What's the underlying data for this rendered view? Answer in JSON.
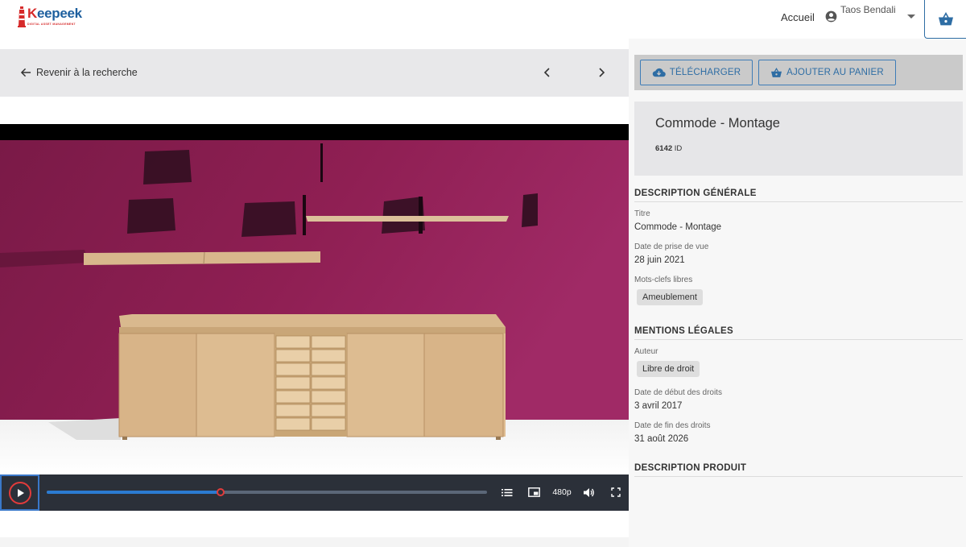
{
  "header": {
    "logo_word_k": "K",
    "logo_word_rest": "eepeek",
    "logo_sub": "DIGITAL ASSET MANAGEMENT",
    "nav_home": "Accueil",
    "user_name": "Taos Bendali"
  },
  "viewer": {
    "back_label": "Revenir à la recherche",
    "player": {
      "progress": 0.395,
      "quality": "480p"
    }
  },
  "actions": {
    "download_label": "TÉLÉCHARGER",
    "add_to_cart_label": "AJOUTER AU PANIER"
  },
  "asset": {
    "title": "Commode - Montage",
    "id_value": "6142",
    "id_label": "ID"
  },
  "sections": {
    "general": {
      "heading": "DESCRIPTION GÉNÉRALE",
      "title_label": "Titre",
      "title_value": "Commode - Montage",
      "shot_date_label": "Date de prise de vue",
      "shot_date_value": "28 juin 2021",
      "keywords_label": "Mots-clefs libres",
      "keywords": [
        "Ameublement"
      ]
    },
    "legal": {
      "heading": "MENTIONS LÉGALES",
      "author_label": "Auteur",
      "author_value": "Libre de droit",
      "rights_start_label": "Date de début des droits",
      "rights_start_value": "3 avril 2017",
      "rights_end_label": "Date de fin des droits",
      "rights_end_value": "31 août 2026"
    },
    "product": {
      "heading": "DESCRIPTION PRODUIT"
    }
  },
  "colors": {
    "brand_blue": "#2e6da4",
    "brand_red": "#d62b2b",
    "scene_wall": "#8e1e52",
    "wood": "#e0bf95"
  }
}
